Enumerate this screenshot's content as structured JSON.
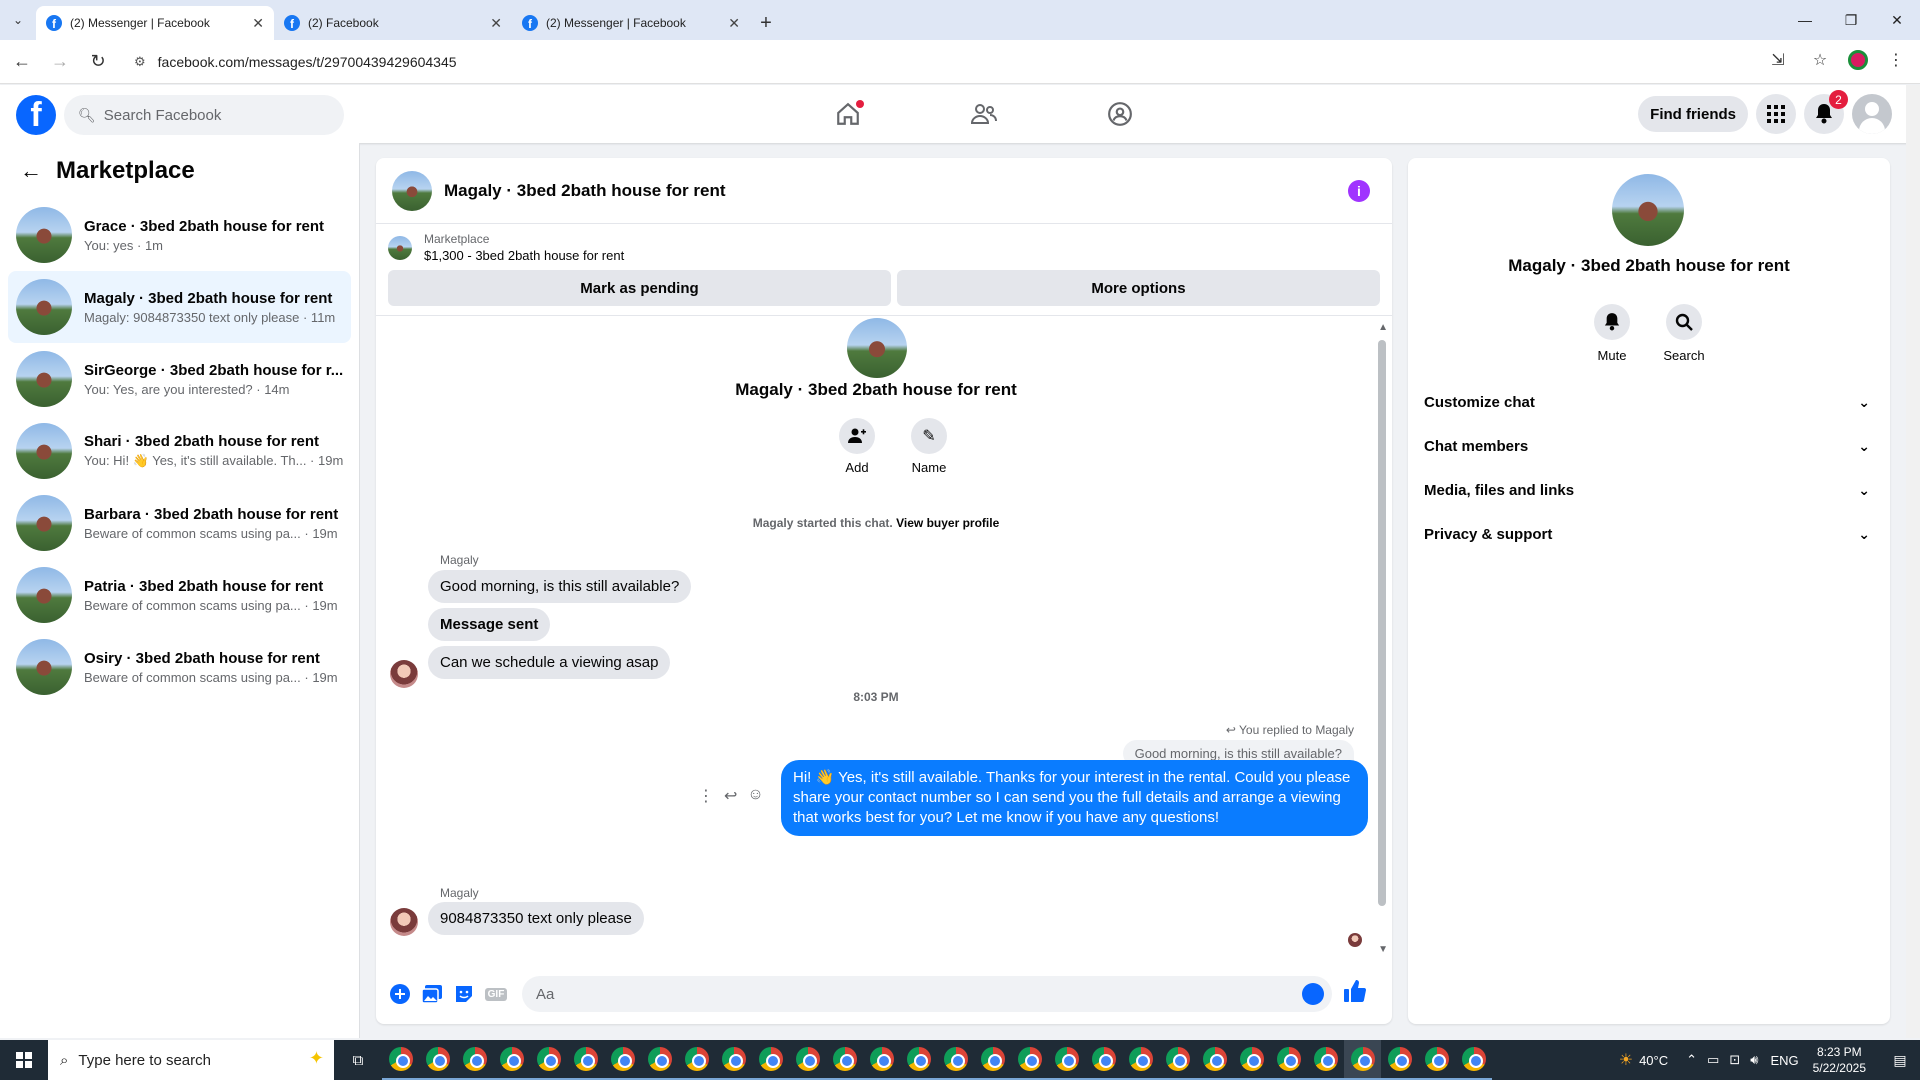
{
  "browser": {
    "tabs": [
      {
        "title": "(2) Messenger | Facebook",
        "active": true
      },
      {
        "title": "(2) Facebook",
        "active": false
      },
      {
        "title": "(2) Messenger | Facebook",
        "active": false
      }
    ],
    "url": "facebook.com/messages/t/29700439429604345"
  },
  "fb": {
    "search_placeholder": "Search Facebook",
    "find_friends": "Find friends",
    "notif_count": "2"
  },
  "left": {
    "title": "Marketplace",
    "conversations": [
      {
        "name": "Grace · 3bed 2bath house for rent",
        "preview": "You: yes · 1m"
      },
      {
        "name": "Magaly · 3bed 2bath house for rent",
        "preview": "Magaly: 9084873350 text only please · 11m"
      },
      {
        "name": "SirGeorge · 3bed 2bath house for r...",
        "preview": "You: Yes, are you interested? · 14m"
      },
      {
        "name": "Shari · 3bed 2bath house for rent",
        "preview": "You: Hi! 👋 Yes, it's still available. Th...  · 19m"
      },
      {
        "name": "Barbara · 3bed 2bath house for rent",
        "preview": "Beware of common scams using pa... · 19m"
      },
      {
        "name": "Patria · 3bed 2bath house for rent",
        "preview": "Beware of common scams using pa... · 19m"
      },
      {
        "name": "Osiry · 3bed 2bath house for rent",
        "preview": "Beware of common scams using pa... · 19m"
      }
    ]
  },
  "chat": {
    "title": "Magaly · 3bed 2bath house for rent",
    "marketplace_label": "Marketplace",
    "listing": "$1,300 - 3bed 2bath house for rent",
    "mark_pending": "Mark as pending",
    "more_options": "More options",
    "intro_name": "Magaly · 3bed 2bath house for rent",
    "add_label": "Add",
    "name_label": "Name",
    "started": "Magaly started this chat.",
    "view_buyer": "View buyer profile",
    "sender1": "Magaly",
    "msg1": "Good morning, is this still available?",
    "msg2": "Message sent",
    "msg3": "Can we schedule a viewing asap",
    "time": "8:03 PM",
    "replied": "You replied to Magaly",
    "quoted": "Good morning, is this still available?",
    "reply": "Hi! 👋 Yes, it's still available. Thanks for your interest in the rental. Could you please share your contact number so I can send you the full details and arrange a viewing that works best for you? Let me know if you have any questions!",
    "sender2": "Magaly",
    "msg4": "9084873350 text only please",
    "composer_placeholder": "Aa"
  },
  "right": {
    "name": "Magaly · 3bed 2bath house for rent",
    "mute": "Mute",
    "search": "Search",
    "sections": [
      "Customize chat",
      "Chat members",
      "Media, files and links",
      "Privacy & support"
    ]
  },
  "taskbar": {
    "search_placeholder": "Type here to search",
    "temp": "40°C",
    "lang": "ENG",
    "time": "8:23 PM",
    "date": "5/22/2025"
  }
}
